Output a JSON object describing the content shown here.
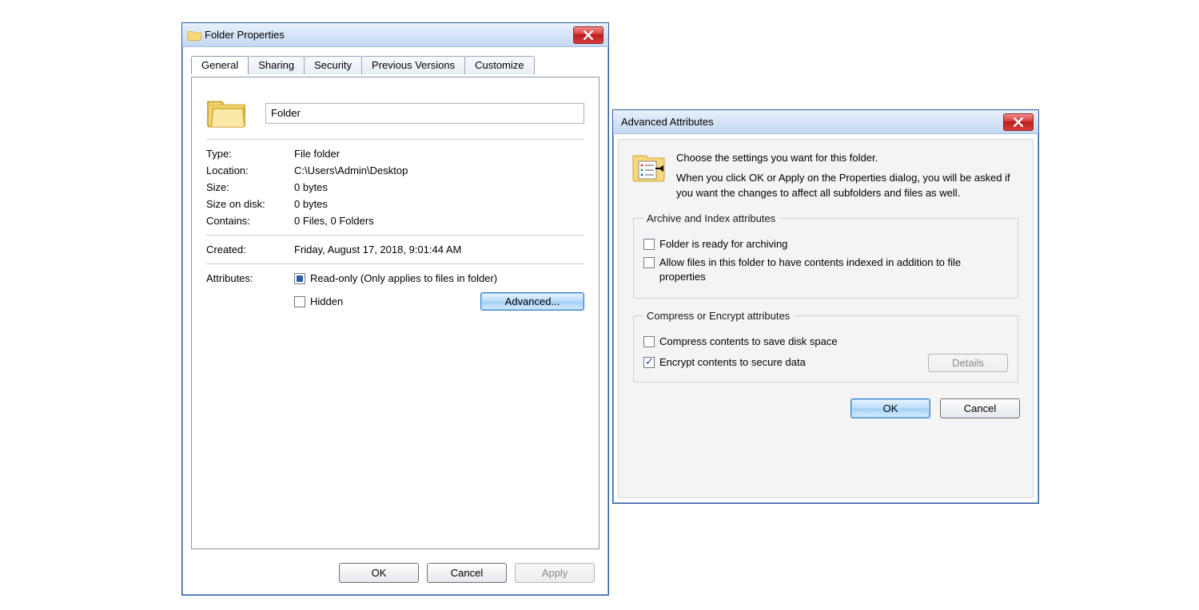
{
  "props": {
    "title": "Folder Properties",
    "tabs": [
      "General",
      "Sharing",
      "Security",
      "Previous Versions",
      "Customize"
    ],
    "active_tab": 0,
    "name_value": "Folder",
    "type_label": "Type:",
    "type_value": "File folder",
    "location_label": "Location:",
    "location_value": "C:\\Users\\Admin\\Desktop",
    "size_label": "Size:",
    "size_value": "0 bytes",
    "sizeondisk_label": "Size on disk:",
    "sizeondisk_value": "0 bytes",
    "contains_label": "Contains:",
    "contains_value": "0 Files, 0 Folders",
    "created_label": "Created:",
    "created_value": "Friday, August 17, 2018, 9:01:44 AM",
    "attributes_label": "Attributes:",
    "readonly_label": "Read-only (Only applies to files in folder)",
    "hidden_label": "Hidden",
    "advanced_button": "Advanced...",
    "ok": "OK",
    "cancel": "Cancel",
    "apply": "Apply"
  },
  "adv": {
    "title": "Advanced Attributes",
    "intro_line1": "Choose the settings you want for this folder.",
    "intro_line2": "When you click OK or Apply on the Properties dialog, you will be asked if you want the changes to affect all subfolders and files as well.",
    "group_archive_legend": "Archive and Index attributes",
    "archive_ready_label": "Folder is ready for archiving",
    "allow_index_label": "Allow files in this folder to have contents indexed in addition to file properties",
    "group_compress_legend": "Compress or Encrypt attributes",
    "compress_label": "Compress contents to save disk space",
    "encrypt_label": "Encrypt contents to secure data",
    "details": "Details",
    "ok": "OK",
    "cancel": "Cancel"
  }
}
